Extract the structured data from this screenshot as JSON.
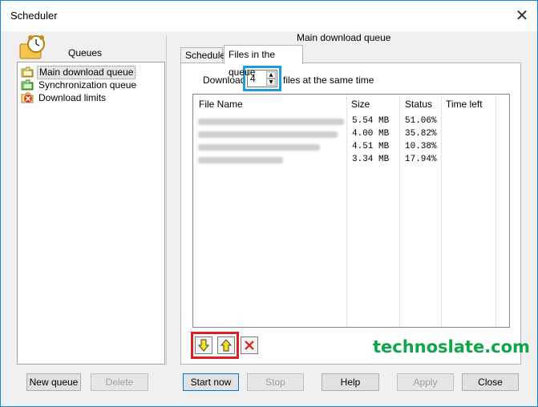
{
  "window": {
    "title": "Scheduler",
    "close_glyph": "✕"
  },
  "left": {
    "heading": "Queues",
    "items": [
      {
        "label": "Main download queue",
        "icon": "queue-folder-icon",
        "selected": true
      },
      {
        "label": "Synchronization queue",
        "icon": "sync-folder-icon",
        "selected": false
      },
      {
        "label": "Download limits",
        "icon": "limits-icon",
        "selected": false
      }
    ],
    "buttons": {
      "new_queue": "New queue",
      "delete": "Delete"
    }
  },
  "right": {
    "title": "Main download queue",
    "tabs": [
      {
        "label": "Schedule",
        "active": false
      },
      {
        "label": "Files in the queue",
        "active": true
      }
    ],
    "download_prefix": "Download",
    "download_count": "4",
    "download_suffix": "files at the same time",
    "table": {
      "columns": [
        "File Name",
        "Size",
        "Status",
        "Time left"
      ],
      "rows": [
        {
          "name_blurred": true,
          "size": "5.54 MB",
          "status": "51.06%",
          "time_left": ""
        },
        {
          "name_blurred": true,
          "size": "4.00 MB",
          "status": "35.82%",
          "time_left": ""
        },
        {
          "name_blurred": true,
          "size": "4.51 MB",
          "status": "10.38%",
          "time_left": ""
        },
        {
          "name_blurred": true,
          "size": "3.34 MB",
          "status": "17.94%",
          "time_left": ""
        }
      ]
    },
    "tools": {
      "move_down": "arrow-down-icon",
      "move_up": "arrow-up-icon",
      "remove": "remove-x-icon"
    },
    "watermark": "technoslate.com"
  },
  "footer": {
    "start_now": "Start now",
    "stop": "Stop",
    "help": "Help",
    "apply": "Apply",
    "close": "Close"
  },
  "colors": {
    "spinner_highlight": "#1a9ce0",
    "order_highlight": "#e02020",
    "watermark": "#11a54a",
    "window_border": "#1883d7"
  }
}
